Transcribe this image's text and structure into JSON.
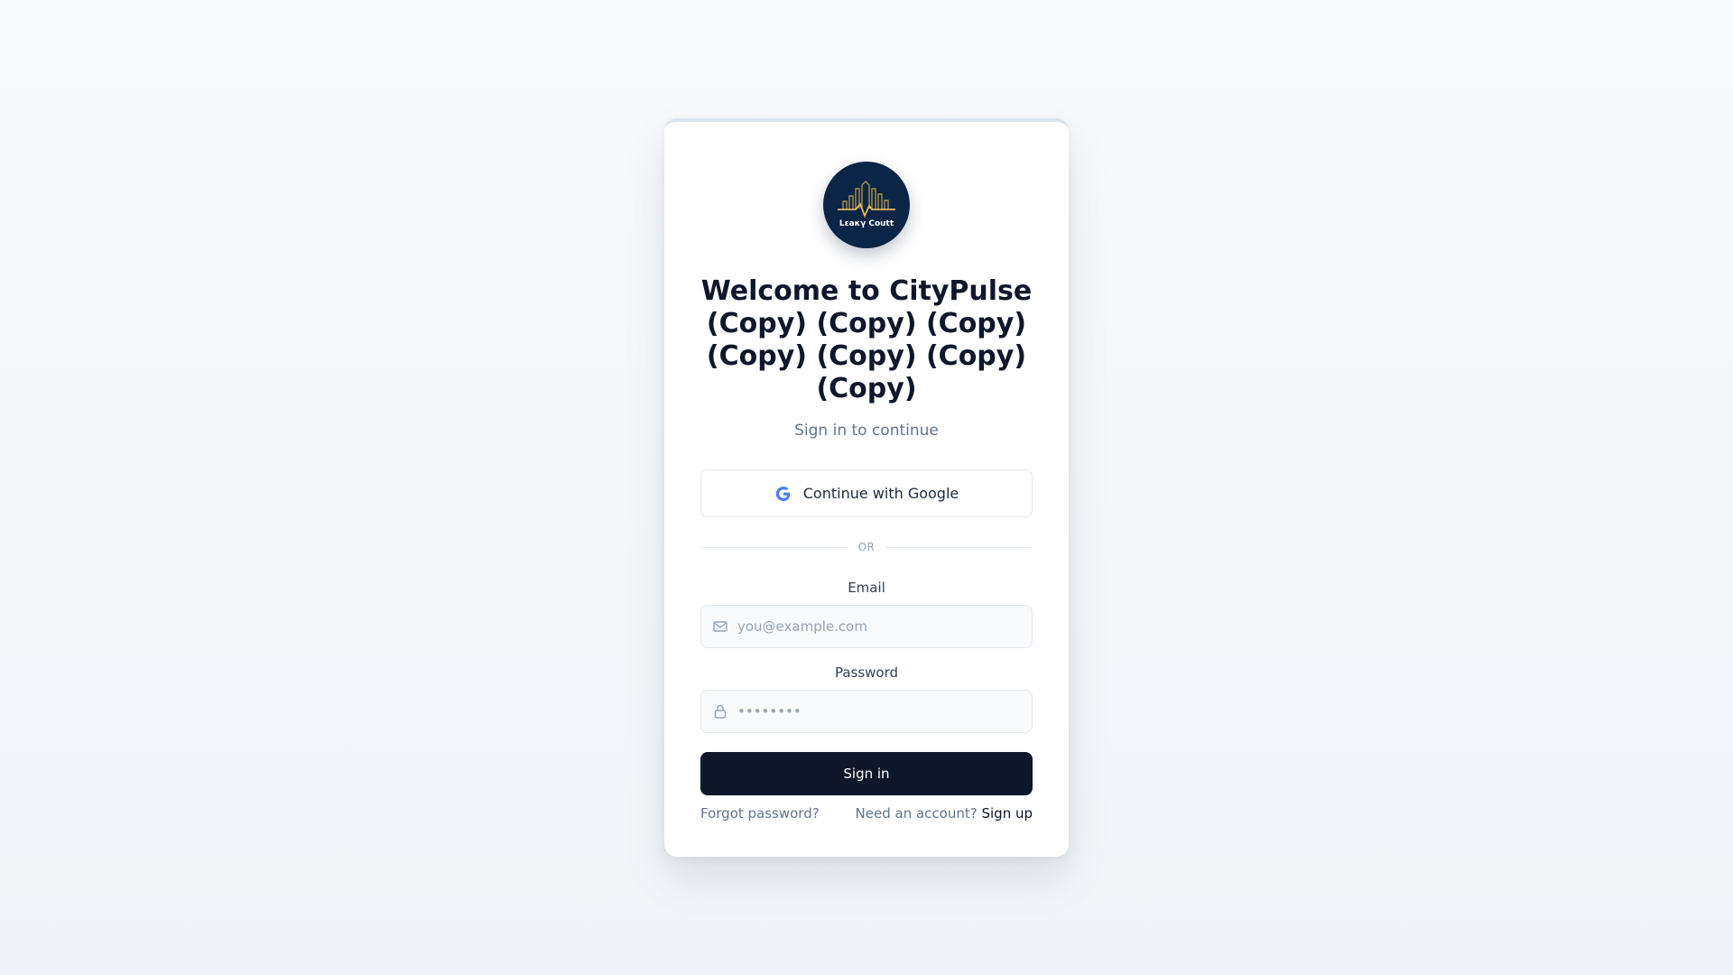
{
  "logo": {
    "text": "Lεaκγ Coutt",
    "background_color": "#0b2546",
    "accent_color": "#c9a24a"
  },
  "header": {
    "title": "Welcome to CityPulse (Copy) (Copy) (Copy) (Copy) (Copy) (Copy) (Copy)",
    "subtitle": "Sign in to continue"
  },
  "google": {
    "label": "Continue with Google",
    "icon": "google-g-icon"
  },
  "divider": {
    "text": "OR"
  },
  "email": {
    "label": "Email",
    "placeholder": "you@example.com",
    "value": "",
    "icon": "mail-icon"
  },
  "password": {
    "label": "Password",
    "placeholder": "••••••••",
    "value": "",
    "icon": "lock-icon"
  },
  "signin": {
    "label": "Sign in",
    "color": "#0f172a"
  },
  "footer": {
    "forgot_label": "Forgot password?",
    "need_account_label": "Need an account?",
    "signup_label": "Sign up"
  }
}
